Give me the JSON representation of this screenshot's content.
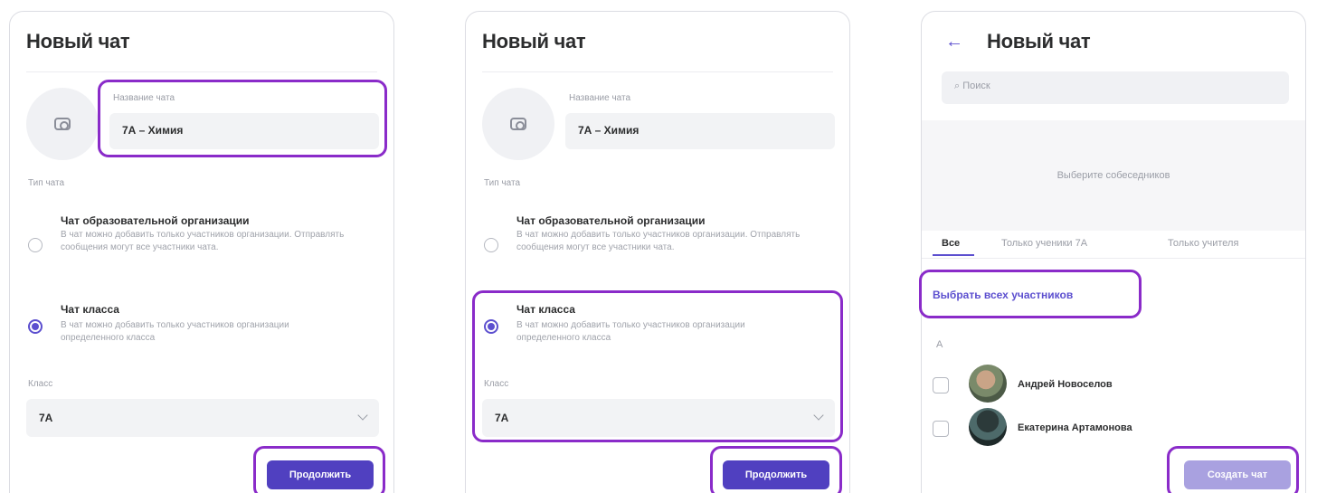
{
  "panel1": {
    "title": "Новый чат",
    "chat_name_label": "Название чата",
    "chat_name_value": "7А – Химия",
    "chat_type_label": "Тип чата",
    "option_org": {
      "title": "Чат образовательной организации",
      "desc": "В чат можно добавить только участников организации. Отправлять сообщения могут все участники чата."
    },
    "option_class": {
      "title": "Чат класса",
      "desc": "В чат можно добавить только участников организации определенного класса"
    },
    "class_label": "Класс",
    "class_value": "7А",
    "continue_button": "Продолжить"
  },
  "panel2": {
    "title": "Новый чат",
    "chat_name_label": "Название чата",
    "chat_name_value": "7А – Химия",
    "chat_type_label": "Тип чата",
    "option_org": {
      "title": "Чат образовательной организации",
      "desc": "В чат можно добавить только участников организации. Отправлять сообщения могут все участники чата."
    },
    "option_class": {
      "title": "Чат класса",
      "desc": "В чат можно добавить только участников организации определенного класса"
    },
    "class_label": "Класс",
    "class_value": "7А",
    "continue_button": "Продолжить"
  },
  "panel3": {
    "title": "Новый чат",
    "back_icon": "arrow-left-icon",
    "search_placeholder": "Поиск",
    "empty_hint": "Выберите собеседников",
    "tabs": [
      "Все",
      "Только ученики 7А",
      "Только учителя"
    ],
    "select_all": "Выбрать всех участников",
    "group_letter": "А",
    "participants": [
      {
        "name": "Андрей Новоселов"
      },
      {
        "name": "Екатерина Артамонова"
      }
    ],
    "create_button": "Создать чат"
  },
  "colors": {
    "accent": "#5040c0",
    "highlight": "#8a2bc9",
    "disabled_button": "#a9a1e0"
  }
}
